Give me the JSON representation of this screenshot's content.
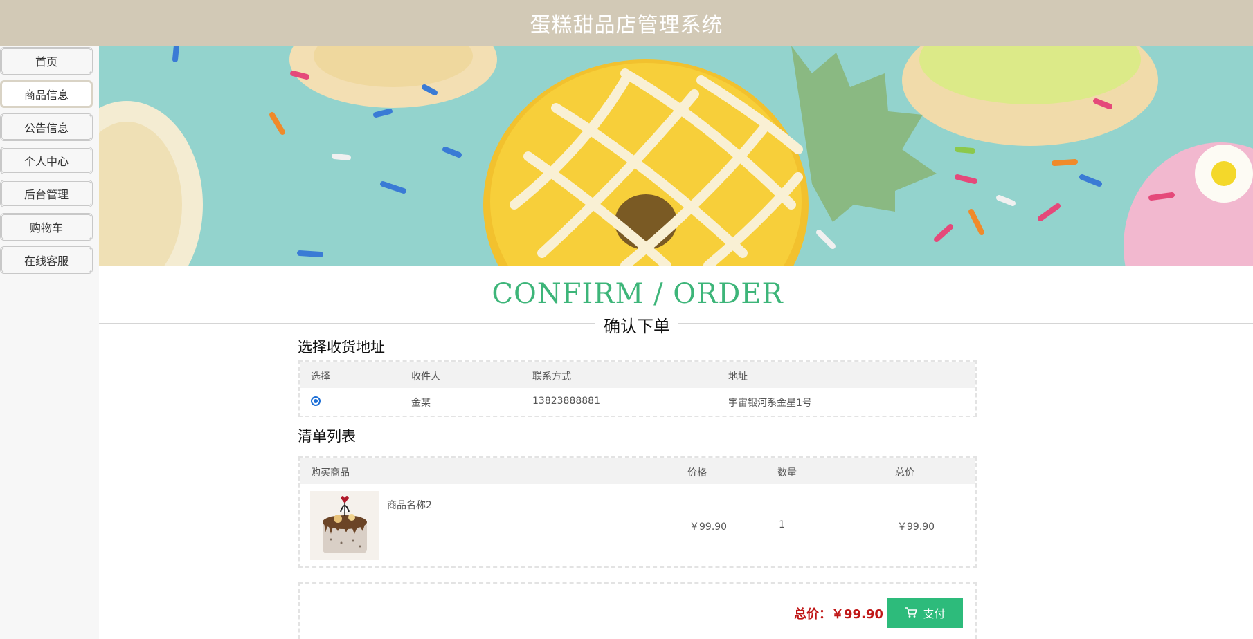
{
  "header": {
    "title": "蛋糕甜品店管理系统"
  },
  "sidebar": {
    "items": [
      {
        "label": "首页"
      },
      {
        "label": "商品信息"
      },
      {
        "label": "公告信息"
      },
      {
        "label": "个人中心"
      },
      {
        "label": "后台管理"
      },
      {
        "label": "购物车"
      },
      {
        "label": "在线客服"
      }
    ],
    "active_index": 1
  },
  "page": {
    "title_en": "CONFIRM / ORDER",
    "title_cn": "确认下单"
  },
  "address": {
    "section_title": "选择收货地址",
    "columns": [
      "选择",
      "收件人",
      "联系方式",
      "地址"
    ],
    "rows": [
      {
        "selected": true,
        "recipient": "金某",
        "phone": "13823888881",
        "address": "宇宙银河系金星1号"
      }
    ]
  },
  "items": {
    "section_title": "清单列表",
    "columns": [
      "购买商品",
      "价格",
      "数量",
      "总价"
    ],
    "rows": [
      {
        "name": "商品名称2",
        "price": "￥99.90",
        "quantity": "1",
        "total": "￥99.90"
      }
    ]
  },
  "summary": {
    "total_label": "总价：",
    "total_value": "￥99.90",
    "pay_label": "支付"
  },
  "colors": {
    "header_bg": "#d2c9b6",
    "accent_green": "#3db579",
    "pay_button": "#2dbb7b",
    "total_red": "#c01717"
  }
}
